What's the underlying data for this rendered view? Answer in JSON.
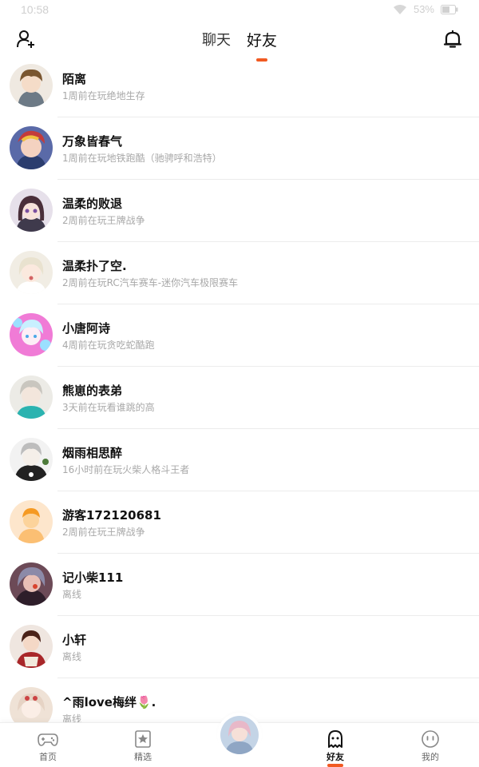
{
  "status_bar": {
    "time": "10:58",
    "battery": "53%",
    "icons": [
      "wifi-icon",
      "battery-icon"
    ]
  },
  "header": {
    "tabs": [
      {
        "label": "聊天",
        "active": false
      },
      {
        "label": "好友",
        "active": true
      }
    ],
    "left_icon": "add-friend-icon",
    "right_icon": "bell-icon",
    "accent_color": "#f15a22"
  },
  "friends": [
    {
      "name": "陌离",
      "status": "1周前在玩绝地生存"
    },
    {
      "name": "万象皆春气",
      "status": "1周前在玩地铁跑酷（驰骋呼和浩特）"
    },
    {
      "name": "温柔的败退",
      "status": "2周前在玩王牌战争"
    },
    {
      "name": "温柔扑了空.",
      "status": "2周前在玩RC汽车赛车-迷你汽车极限赛车"
    },
    {
      "name": "小唐阿诗",
      "status": "4周前在玩贪吃蛇酷跑"
    },
    {
      "name": "熊崽的表弟",
      "status": "3天前在玩看谁跳的高"
    },
    {
      "name": "烟雨相思醉",
      "status": "16小时前在玩火柴人格斗王者"
    },
    {
      "name": "游客172120681",
      "status": "2周前在玩王牌战争"
    },
    {
      "name": "记小柴111",
      "status": "离线"
    },
    {
      "name": "小轩",
      "status": "离线"
    },
    {
      "name": "^雨love梅绊🌷.",
      "status": "离线"
    }
  ],
  "bottom_nav": {
    "items": [
      {
        "label": "首页",
        "icon": "gamepad-icon",
        "active": false
      },
      {
        "label": "精选",
        "icon": "star-card-icon",
        "active": false
      },
      {
        "label": "",
        "icon": "avatar-center",
        "active": false
      },
      {
        "label": "好友",
        "icon": "ghost-icon",
        "active": true
      },
      {
        "label": "我的",
        "icon": "face-icon",
        "active": false
      }
    ]
  }
}
